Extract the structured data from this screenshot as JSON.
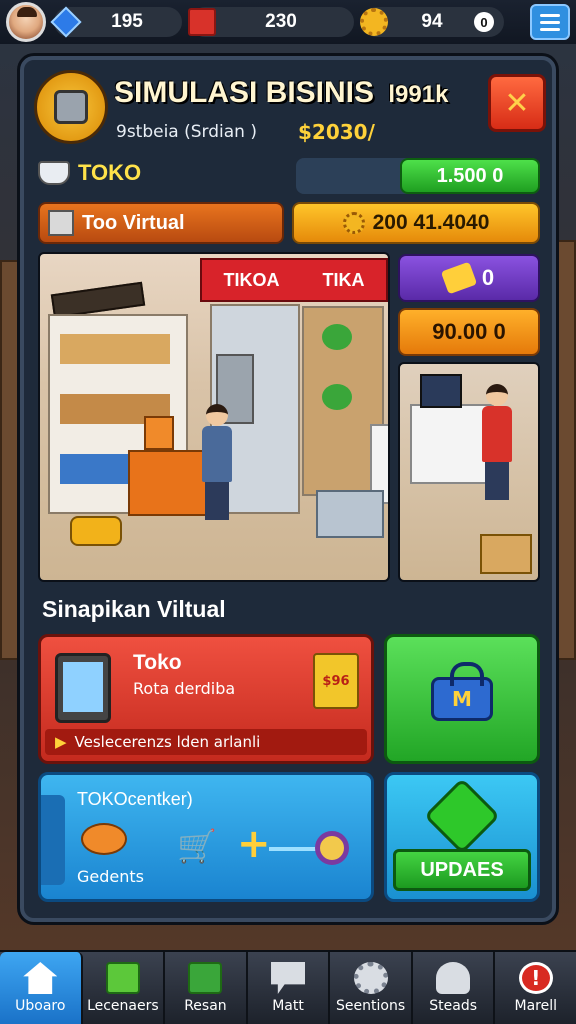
{
  "topbar": {
    "gems": "195",
    "crates": "230",
    "coins": "94",
    "coin_badge": "0"
  },
  "header": {
    "title": "SIMULASI BISINIS",
    "title_suffix": "l991k",
    "subtitle": "9stbeia (Srdian )",
    "subvalue": "$2030/",
    "close_icon": "x"
  },
  "stats": {
    "toko_label": "TOKO",
    "toko_bar_value": "1.500 0",
    "virtual_label": "Too Virtual",
    "virtual_value": "200 41.4040"
  },
  "scene": {
    "banner_left": "TIKOA",
    "banner_right": "TIKA",
    "side_purple_value": "0",
    "side_orange_value": "90.00 0"
  },
  "section": {
    "title": "Sinapikan Viltual"
  },
  "cards": {
    "red": {
      "title": "Toko",
      "subtitle": "Rota derdiba",
      "footer": "Veslecerenzs lden arlanli",
      "bag_label": "$96"
    },
    "green": {
      "lock_label": "M"
    },
    "blue": {
      "title": "TOKOcentker)",
      "footer": "Gedents"
    },
    "teal": {
      "button_label": "UPDAES"
    }
  },
  "nav": {
    "items": [
      {
        "label": "Uboaro",
        "icon": "home-icon"
      },
      {
        "label": "Lecenaers",
        "icon": "cube-icon"
      },
      {
        "label": "Resan",
        "icon": "cubes-icon"
      },
      {
        "label": "Matt",
        "icon": "flag-icon"
      },
      {
        "label": "Seentions",
        "icon": "cog-icon"
      },
      {
        "label": "Steads",
        "icon": "user-icon"
      },
      {
        "label": "Marell",
        "icon": "alert-icon"
      }
    ]
  }
}
